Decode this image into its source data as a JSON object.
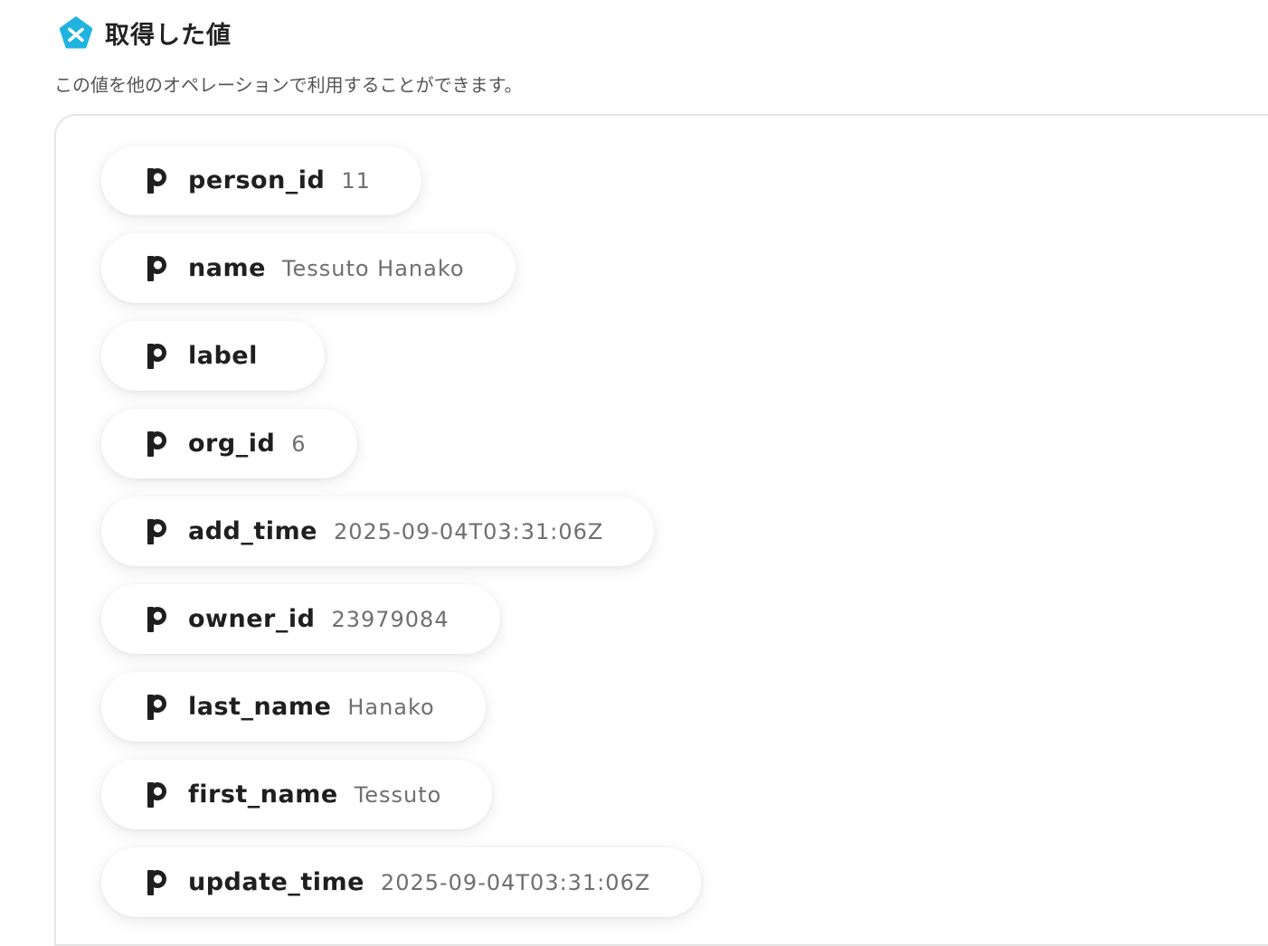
{
  "header": {
    "title": "取得した値",
    "subtitle": "この値を他のオペレーションで利用することができます。",
    "logo_icon": "yoom-pentagon-icon",
    "accent_color": "#1fb3e0"
  },
  "values": {
    "item_icon": "pipedrive-p-icon",
    "items": [
      {
        "key": "person_id",
        "value": "11"
      },
      {
        "key": "name",
        "value": "Tessuto Hanako"
      },
      {
        "key": "label",
        "value": ""
      },
      {
        "key": "org_id",
        "value": "6"
      },
      {
        "key": "add_time",
        "value": "2025-09-04T03:31:06Z"
      },
      {
        "key": "owner_id",
        "value": "23979084"
      },
      {
        "key": "last_name",
        "value": "Hanako"
      },
      {
        "key": "first_name",
        "value": "Tessuto"
      },
      {
        "key": "update_time",
        "value": "2025-09-04T03:31:06Z"
      }
    ]
  }
}
